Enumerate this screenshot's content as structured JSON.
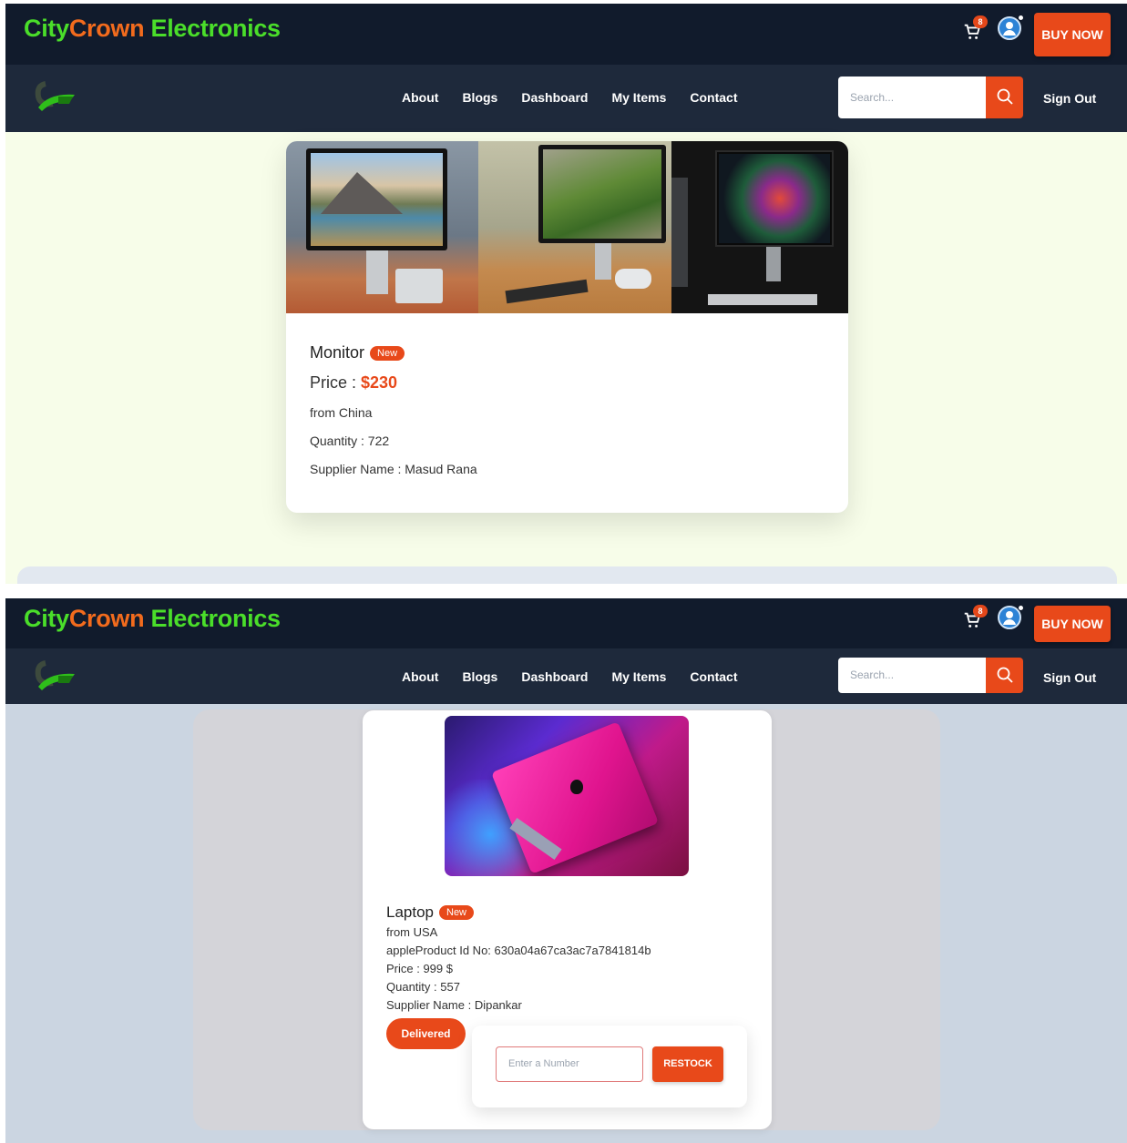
{
  "header": {
    "brand": {
      "part1": "City",
      "part2": "Crown",
      "part3": " Electronics"
    },
    "cart_count": "8",
    "buy_now_label": "BUY NOW"
  },
  "nav": {
    "links": [
      "About",
      "Blogs",
      "Dashboard",
      "My Items",
      "Contact"
    ],
    "search_placeholder": "Search...",
    "sign_out_label": "Sign Out"
  },
  "product1": {
    "name": "Monitor",
    "badge": "New",
    "price_label": "Price : ",
    "price_value": "$230",
    "origin": "from China",
    "quantity": "Quantity : 722",
    "supplier": "Supplier Name : Masud Rana"
  },
  "product2": {
    "name": "Laptop",
    "badge": "New",
    "origin": "from USA",
    "product_id": "appleProduct Id No: 630a04a67ca3ac7a7841814b",
    "price": "Price : 999 $",
    "quantity": "Quantity : 557",
    "supplier": "Supplier Name : Dipankar",
    "delivered_label": "Delivered",
    "restock_placeholder": "Enter a Number",
    "restock_label": "RESTOCK"
  },
  "colors": {
    "accent": "#e8491a",
    "topbar": "#111b2c",
    "navbar": "#1e293b",
    "brand_green": "#4ade2a",
    "brand_orange": "#f26b1d"
  },
  "icons": [
    "cart-icon",
    "user-icon",
    "search-icon",
    "logo-icon"
  ]
}
